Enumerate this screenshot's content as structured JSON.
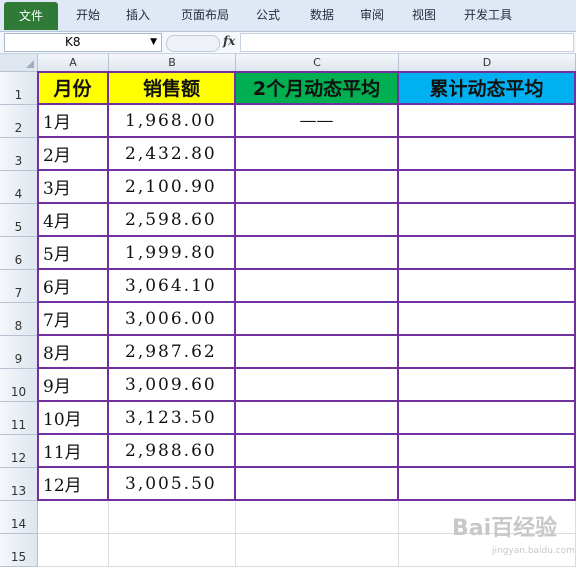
{
  "ribbon": {
    "tabs": [
      "文件",
      "开始",
      "插入",
      "页面布局",
      "公式",
      "数据",
      "审阅",
      "视图",
      "开发工具"
    ]
  },
  "formula_bar": {
    "name_box": "K8",
    "fx": "fx",
    "formula": ""
  },
  "columns": [
    "A",
    "B",
    "C",
    "D"
  ],
  "rows": [
    "1",
    "2",
    "3",
    "4",
    "5",
    "6",
    "7",
    "8",
    "9",
    "10",
    "11",
    "12",
    "13",
    "14",
    "15"
  ],
  "table": {
    "headers": [
      "月份",
      "销售额",
      "2个月动态平均",
      "累计动态平均"
    ],
    "header_colors": [
      "#ffff00",
      "#ffff00",
      "#00b050",
      "#00b0f0"
    ],
    "border_color": "#7030a0",
    "body": [
      [
        "1月",
        "1,968.00",
        "——",
        ""
      ],
      [
        "2月",
        "2,432.80",
        "",
        ""
      ],
      [
        "3月",
        "2,100.90",
        "",
        ""
      ],
      [
        "4月",
        "2,598.60",
        "",
        ""
      ],
      [
        "5月",
        "1,999.80",
        "",
        ""
      ],
      [
        "6月",
        "3,064.10",
        "",
        ""
      ],
      [
        "7月",
        "3,006.00",
        "",
        ""
      ],
      [
        "8月",
        "2,987.62",
        "",
        ""
      ],
      [
        "9月",
        "3,009.60",
        "",
        ""
      ],
      [
        "10月",
        "3,123.50",
        "",
        ""
      ],
      [
        "11月",
        "2,988.60",
        "",
        ""
      ],
      [
        "12月",
        "3,005.50",
        "",
        ""
      ]
    ]
  },
  "watermark": {
    "text": "Bai百经验",
    "sub": "jingyan.baidu.com"
  }
}
